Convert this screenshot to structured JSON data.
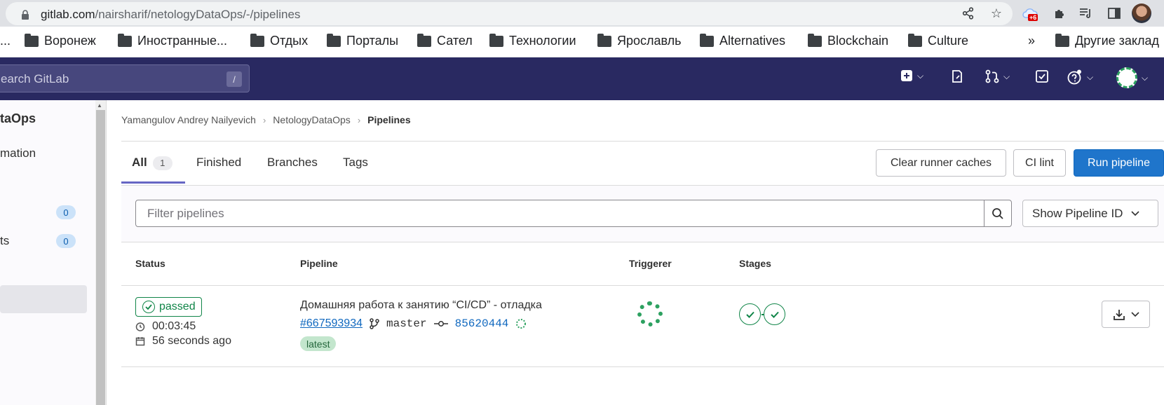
{
  "browser": {
    "url_host": "gitlab.com",
    "url_path": "/nairsharif/netologyDataOps/-/pipelines",
    "extension_badge": "+6",
    "more_bookmarks": "»",
    "bookmarks": [
      {
        "label": "Воронеж"
      },
      {
        "label": "Иностранные..."
      },
      {
        "label": "Отдых"
      },
      {
        "label": "Порталы"
      },
      {
        "label": "Сател"
      },
      {
        "label": "Технологии"
      },
      {
        "label": "Ярославль"
      },
      {
        "label": "Alternatives"
      },
      {
        "label": "Blockchain"
      },
      {
        "label": "Culture"
      }
    ],
    "other_bookmarks": "Другие заклад",
    "leading_ellipsis": "..."
  },
  "header": {
    "search_placeholder": "earch GitLab",
    "search_shortcut": "/"
  },
  "sidebar": {
    "project_title": "taOps",
    "items": [
      {
        "label": "mation"
      },
      {
        "label": "",
        "count": "0"
      },
      {
        "label": "ts",
        "count": "0"
      }
    ]
  },
  "breadcrumb": {
    "items": [
      "Yamangulov Andrey Nailyevich",
      "NetologyDataOps",
      "Pipelines"
    ]
  },
  "tabs": [
    {
      "label": "All",
      "count": "1"
    },
    {
      "label": "Finished"
    },
    {
      "label": "Branches"
    },
    {
      "label": "Tags"
    }
  ],
  "actions": {
    "clear_caches": "Clear runner caches",
    "ci_lint": "CI lint",
    "run_pipeline": "Run pipeline"
  },
  "filter": {
    "placeholder": "Filter pipelines",
    "show_id_label": "Show Pipeline ID"
  },
  "table": {
    "headers": [
      "Status",
      "Pipeline",
      "Triggerer",
      "Stages"
    ],
    "rows": [
      {
        "status": "passed",
        "duration": "00:03:45",
        "finished": "56 seconds ago",
        "title": "Домашняя работа к занятию “CI/CD” - отладка",
        "pipeline_id": "#667593934",
        "branch": "master",
        "commit": "85620444",
        "label": "latest",
        "stages": [
          "passed",
          "passed"
        ]
      }
    ]
  },
  "colors": {
    "header_bg": "#292961",
    "primary": "#1f75cb",
    "success": "#108548",
    "link": "#1068bf"
  }
}
